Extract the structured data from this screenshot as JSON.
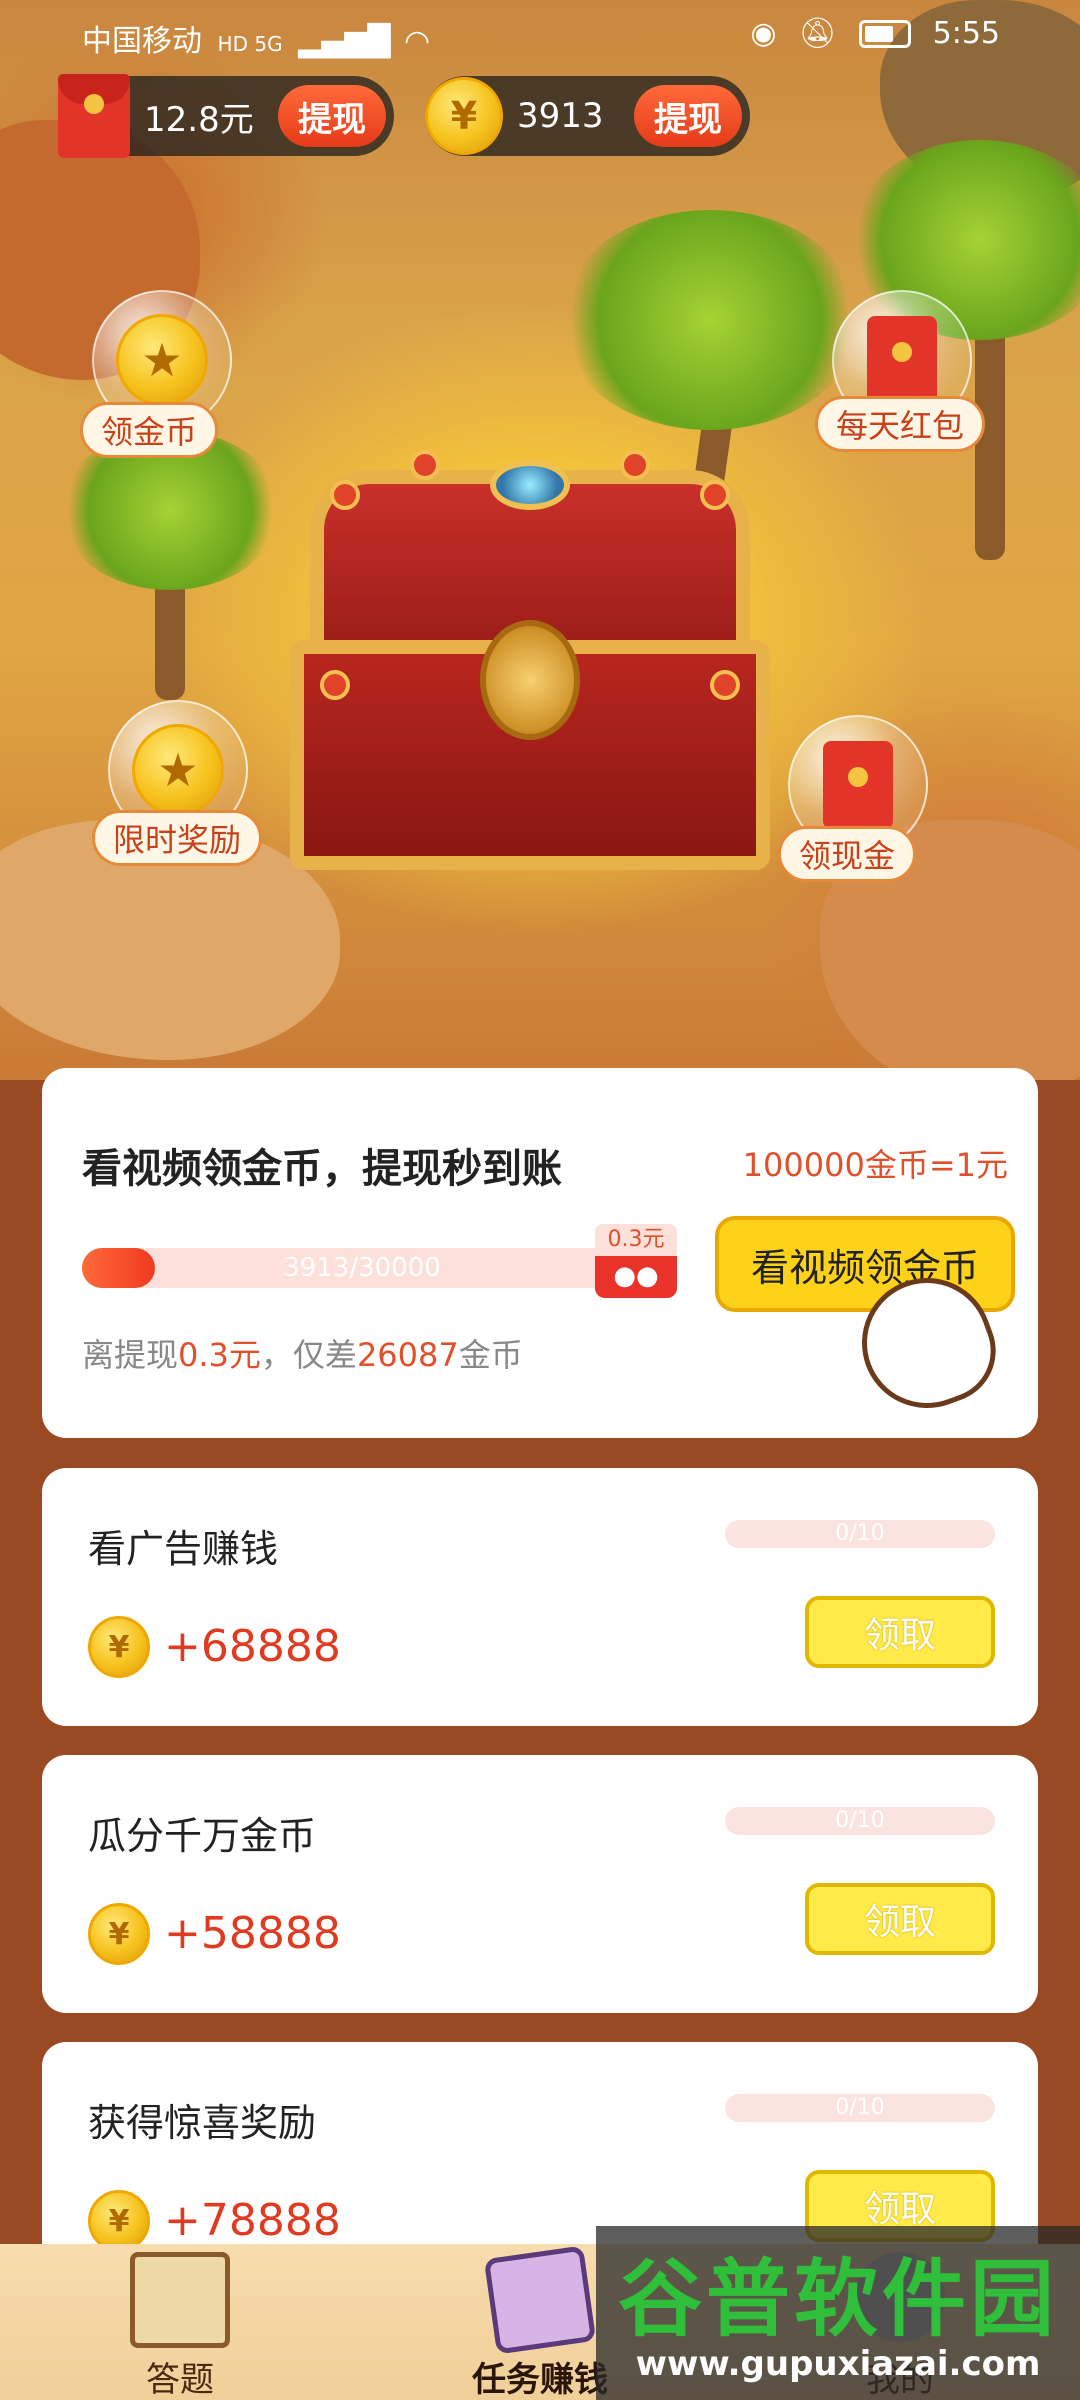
{
  "status_bar": {
    "carrier": "中国移动",
    "network": "HD 5G",
    "time": "5:55"
  },
  "balances": {
    "cash": "12.8元",
    "cash_withdraw": "提现",
    "coins": "3913",
    "coins_withdraw": "提现"
  },
  "side_actions": [
    {
      "label": "领金币",
      "icon": "coin-icon"
    },
    {
      "label": "每天红包",
      "icon": "red-envelope-icon"
    },
    {
      "label": "限时奖励",
      "icon": "coin-icon"
    },
    {
      "label": "领现金",
      "icon": "red-envelope-icon"
    }
  ],
  "main_card": {
    "title": "看视频领金币，提现秒到账",
    "rate": "100000金币=1元",
    "progress_text": "3913/30000",
    "progress_fraction": 0.13,
    "badge": "0.3元",
    "watch_button": "看视频领金币",
    "note_prefix": "离提现",
    "note_amount": "0.3元",
    "note_mid": "，仅差",
    "note_coins": "26087",
    "note_suffix": "金币"
  },
  "tasks": [
    {
      "name": "看广告赚钱",
      "progress": "0/10",
      "reward": "+68888",
      "button": "领取"
    },
    {
      "name": "瓜分千万金币",
      "progress": "0/10",
      "reward": "+58888",
      "button": "领取"
    },
    {
      "name": "获得惊喜奖励",
      "progress": "0/10",
      "reward": "+78888",
      "button": "领取"
    }
  ],
  "bottom_nav": [
    {
      "label": "答题",
      "icon": "scroll-icon"
    },
    {
      "label": "任务赚钱",
      "icon": "task-book-icon"
    },
    {
      "label": "我的",
      "icon": "profile-icon"
    }
  ],
  "watermark": {
    "name": "谷普软件园",
    "url": "www.gupuxiazai.com"
  },
  "colors": {
    "accent_red": "#e03a20",
    "button_yellow": "#ffd21a",
    "background_brown": "#9a4a22"
  }
}
